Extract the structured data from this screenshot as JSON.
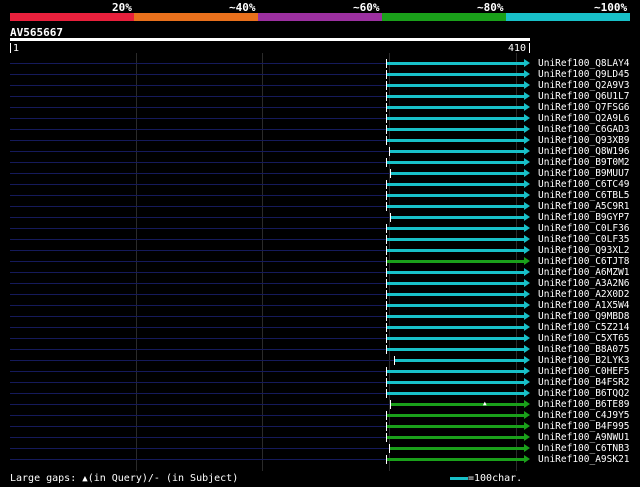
{
  "legend": {
    "labels": [
      "20%",
      "~40%",
      "~60%",
      "~80%",
      "~100%"
    ],
    "colors": [
      "#e8203c",
      "#e8701c",
      "#9c30a0",
      "#1aa01a",
      "#18c0c8"
    ]
  },
  "query": {
    "id": "AV565667",
    "start": "1",
    "end": "410",
    "length": 410
  },
  "hits": [
    {
      "name": "UniRef100_Q8LAY4",
      "start": 300,
      "end": 410,
      "color": "#18c0c8"
    },
    {
      "name": "UniRef100_Q9LD45",
      "start": 300,
      "end": 410,
      "color": "#18c0c8"
    },
    {
      "name": "UniRef100_Q2A9V3",
      "start": 300,
      "end": 410,
      "color": "#18c0c8"
    },
    {
      "name": "UniRef100_Q6U1L7",
      "start": 300,
      "end": 410,
      "color": "#18c0c8"
    },
    {
      "name": "UniRef100_Q7FSG6",
      "start": 300,
      "end": 410,
      "color": "#18c0c8"
    },
    {
      "name": "UniRef100_Q2A9L6",
      "start": 300,
      "end": 410,
      "color": "#18c0c8"
    },
    {
      "name": "UniRef100_C6GAD3",
      "start": 300,
      "end": 410,
      "color": "#18c0c8"
    },
    {
      "name": "UniRef100_Q93XB9",
      "start": 300,
      "end": 410,
      "color": "#18c0c8"
    },
    {
      "name": "UniRef100_Q8W196",
      "start": 302,
      "end": 410,
      "color": "#18c0c8"
    },
    {
      "name": "UniRef100_B9T0M2",
      "start": 300,
      "end": 410,
      "color": "#18c0c8"
    },
    {
      "name": "UniRef100_B9MUU7",
      "start": 303,
      "end": 410,
      "color": "#18c0c8"
    },
    {
      "name": "UniRef100_C6TC49",
      "start": 300,
      "end": 410,
      "color": "#18c0c8"
    },
    {
      "name": "UniRef100_C6TBL5",
      "start": 300,
      "end": 410,
      "color": "#18c0c8"
    },
    {
      "name": "UniRef100_A5C9R1",
      "start": 300,
      "end": 410,
      "color": "#18c0c8"
    },
    {
      "name": "UniRef100_B9GYP7",
      "start": 303,
      "end": 410,
      "color": "#18c0c8"
    },
    {
      "name": "UniRef100_C0LF36",
      "start": 300,
      "end": 410,
      "color": "#18c0c8"
    },
    {
      "name": "UniRef100_C0LF35",
      "start": 300,
      "end": 410,
      "color": "#18c0c8"
    },
    {
      "name": "UniRef100_Q93XL2",
      "start": 300,
      "end": 410,
      "color": "#18c0c8"
    },
    {
      "name": "UniRef100_C6TJT8",
      "start": 300,
      "end": 410,
      "color": "#1aa01a"
    },
    {
      "name": "UniRef100_A6MZW1",
      "start": 300,
      "end": 410,
      "color": "#18c0c8"
    },
    {
      "name": "UniRef100_A3A2N6",
      "start": 300,
      "end": 410,
      "color": "#18c0c8"
    },
    {
      "name": "UniRef100_A2X0D2",
      "start": 300,
      "end": 410,
      "color": "#18c0c8"
    },
    {
      "name": "UniRef100_A1X5W4",
      "start": 300,
      "end": 410,
      "color": "#18c0c8"
    },
    {
      "name": "UniRef100_Q9MBD8",
      "start": 300,
      "end": 410,
      "color": "#18c0c8"
    },
    {
      "name": "UniRef100_C5Z214",
      "start": 300,
      "end": 410,
      "color": "#18c0c8"
    },
    {
      "name": "UniRef100_C5XT65",
      "start": 300,
      "end": 410,
      "color": "#18c0c8"
    },
    {
      "name": "UniRef100_B8A075",
      "start": 300,
      "end": 410,
      "color": "#18c0c8"
    },
    {
      "name": "UniRef100_B2LYK3",
      "start": 306,
      "end": 410,
      "color": "#18c0c8"
    },
    {
      "name": "UniRef100_C0HEF5",
      "start": 300,
      "end": 410,
      "color": "#18c0c8"
    },
    {
      "name": "UniRef100_B4FSR2",
      "start": 300,
      "end": 410,
      "color": "#18c0c8"
    },
    {
      "name": "UniRef100_B6TQQ2",
      "start": 300,
      "end": 410,
      "color": "#18c0c8"
    },
    {
      "name": "UniRef100_B6TE89",
      "start": 303,
      "end": 410,
      "color": "#1aa01a"
    },
    {
      "name": "UniRef100_C4J9Y5",
      "start": 300,
      "end": 410,
      "color": "#1aa01a"
    },
    {
      "name": "UniRef100_B4F995",
      "start": 300,
      "end": 410,
      "color": "#1aa01a"
    },
    {
      "name": "UniRef100_A9NWU1",
      "start": 300,
      "end": 410,
      "color": "#1aa01a"
    },
    {
      "name": "UniRef100_C6TNB3",
      "start": 302,
      "end": 410,
      "color": "#1aa01a"
    },
    {
      "name": "UniRef100_A9SK21",
      "start": 300,
      "end": 410,
      "color": "#1aa01a"
    }
  ],
  "footer": {
    "gaps_label": "Large gaps:",
    "gaps_query": "(in Query)/",
    "gaps_subject": "- (in Subject)",
    "scale_label": "=100char."
  }
}
